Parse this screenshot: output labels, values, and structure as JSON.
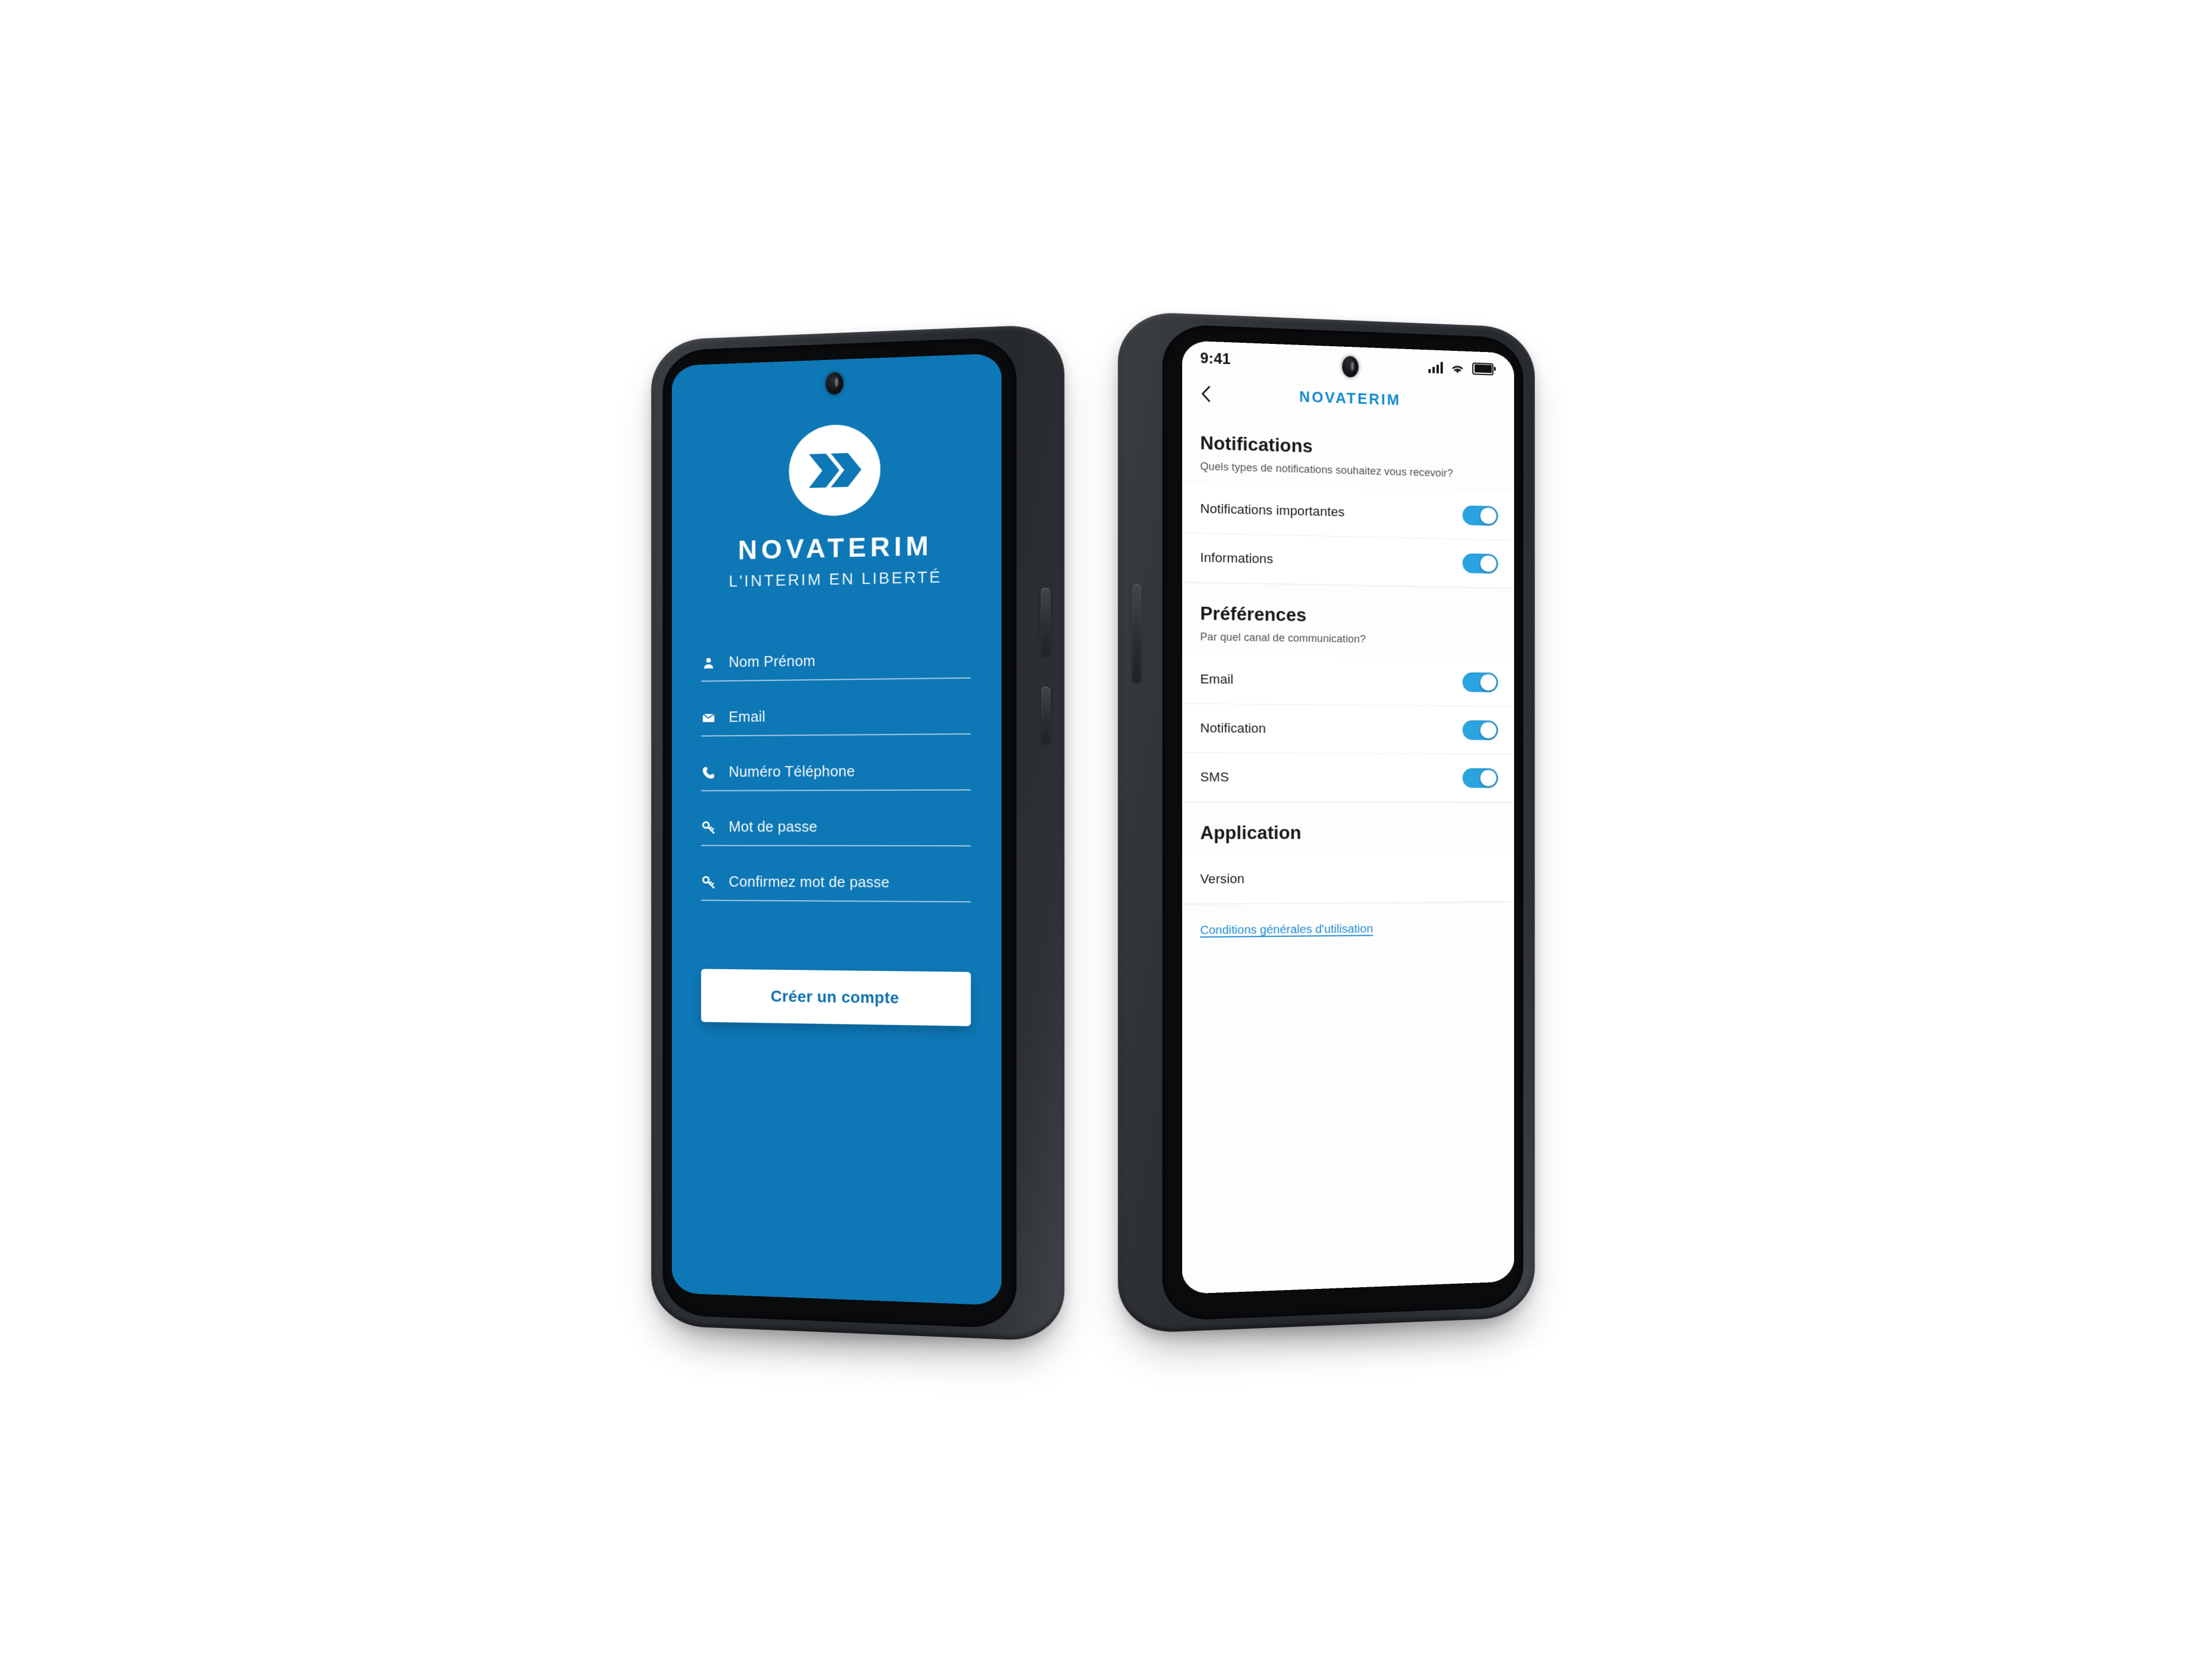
{
  "brand": {
    "accent_blue": "#0E77B5",
    "toggle_blue": "#2BA3E0",
    "link_blue": "#1E8BD4",
    "title_blue": "#1489CE",
    "name": "NOVATERIM",
    "tagline": "L'INTERIM EN LIBERTÉ",
    "logo_icon": "double-chevron-icon"
  },
  "signup_screen": {
    "logo_icon": "novaterim-chevron-logo-icon",
    "brand_name": "NOVATERIM",
    "tagline": "L'INTERIM EN LIBERTÉ",
    "fields": [
      {
        "icon": "user-icon",
        "placeholder": "Nom Prénom",
        "value": ""
      },
      {
        "icon": "email-icon",
        "placeholder": "Email",
        "value": ""
      },
      {
        "icon": "phone-icon",
        "placeholder": "Numéro Téléphone",
        "value": ""
      },
      {
        "icon": "key-icon",
        "placeholder": "Mot de passe",
        "value": ""
      },
      {
        "icon": "key-icon",
        "placeholder": "Confirmez mot de passe",
        "value": ""
      }
    ],
    "submit_label": "Créer un compte"
  },
  "settings_screen": {
    "statusbar": {
      "time": "9:41",
      "signal_icon": "cellular-signal-icon",
      "wifi_icon": "wifi-icon",
      "battery_icon": "battery-full-icon"
    },
    "navbar": {
      "back_icon": "chevron-left-icon",
      "title": "NOVATERIM"
    },
    "sections": [
      {
        "title": "Notifications",
        "subtitle": "Quels types de notifications souhaitez vous recevoir?",
        "rows": [
          {
            "label": "Notifications importantes",
            "toggle": true
          },
          {
            "label": "Informations",
            "toggle": true
          }
        ]
      },
      {
        "title": "Préférences",
        "subtitle": "Par quel canal de communication?",
        "rows": [
          {
            "label": "Email",
            "toggle": true
          },
          {
            "label": "Notification",
            "toggle": true
          },
          {
            "label": "SMS",
            "toggle": true
          }
        ]
      },
      {
        "title": "Application",
        "subtitle": "",
        "rows": [
          {
            "label": "Version",
            "toggle": null,
            "value": ""
          }
        ]
      }
    ],
    "legal_link": "Conditions générales d'utilisation"
  }
}
